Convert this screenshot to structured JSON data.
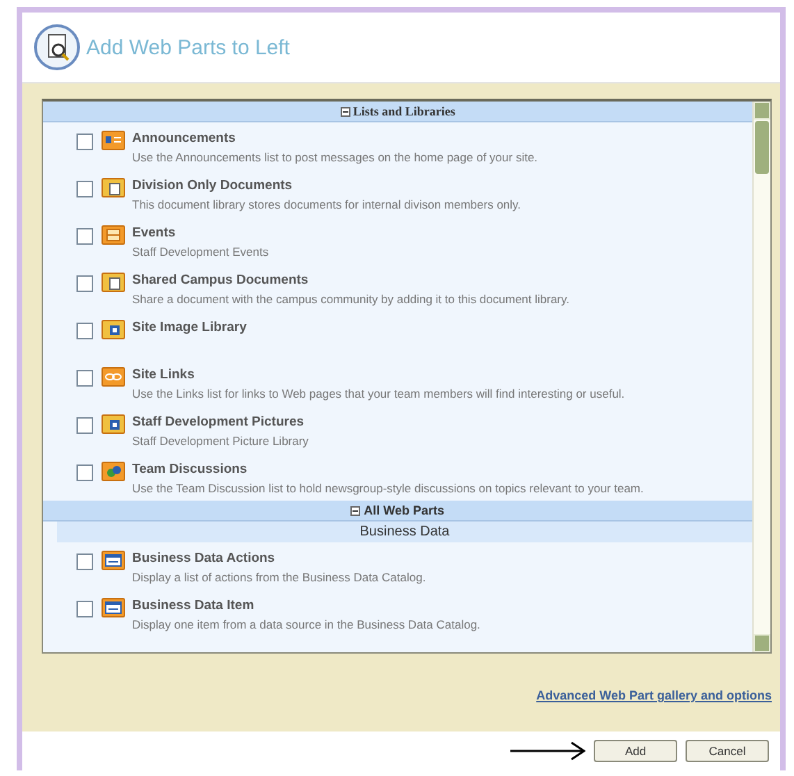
{
  "window": {
    "title": "Add Web Parts to Left"
  },
  "sections": [
    {
      "label": "Lists and Libraries",
      "expanded": true,
      "items": [
        {
          "kind": "list",
          "title": "Announcements",
          "description": "Use the Announcements list to post messages on the home page of your site.",
          "checked": false
        },
        {
          "kind": "library",
          "title": "Division Only Documents",
          "description": "This document library stores documents for internal divison members only.",
          "checked": false
        },
        {
          "kind": "events",
          "title": "Events",
          "description": "Staff Development Events",
          "checked": false
        },
        {
          "kind": "library",
          "title": "Shared Campus Documents",
          "description": "Share a document with the campus community by adding it to this document library.",
          "checked": false
        },
        {
          "kind": "picture",
          "title": "Site Image Library",
          "checked": false
        },
        {
          "kind": "links",
          "title": "Site Links",
          "description": "Use the Links list for links to Web pages that your team members will find interesting or useful.",
          "checked": false
        },
        {
          "kind": "picture",
          "title": "Staff Development Pictures",
          "description": "Staff Development Picture Library",
          "checked": false
        },
        {
          "kind": "discussion",
          "title": "Team Discussions",
          "description": "Use the Team Discussion list to hold newsgroup-style discussions on topics relevant to your team.",
          "checked": false
        }
      ]
    },
    {
      "label": "All Web Parts",
      "expanded": true,
      "group": "Business Data",
      "items": [
        {
          "kind": "webpart",
          "title": "Business Data Actions",
          "description": "Display a list of actions from the Business Data Catalog.",
          "checked": false
        },
        {
          "kind": "webpart",
          "title": "Business Data Item",
          "description": "Display one item from a data source in the Business Data Catalog.",
          "checked": false
        }
      ]
    }
  ],
  "advanced_link": "Advanced Web Part gallery and options",
  "buttons": [
    "Add",
    "Cancel"
  ]
}
